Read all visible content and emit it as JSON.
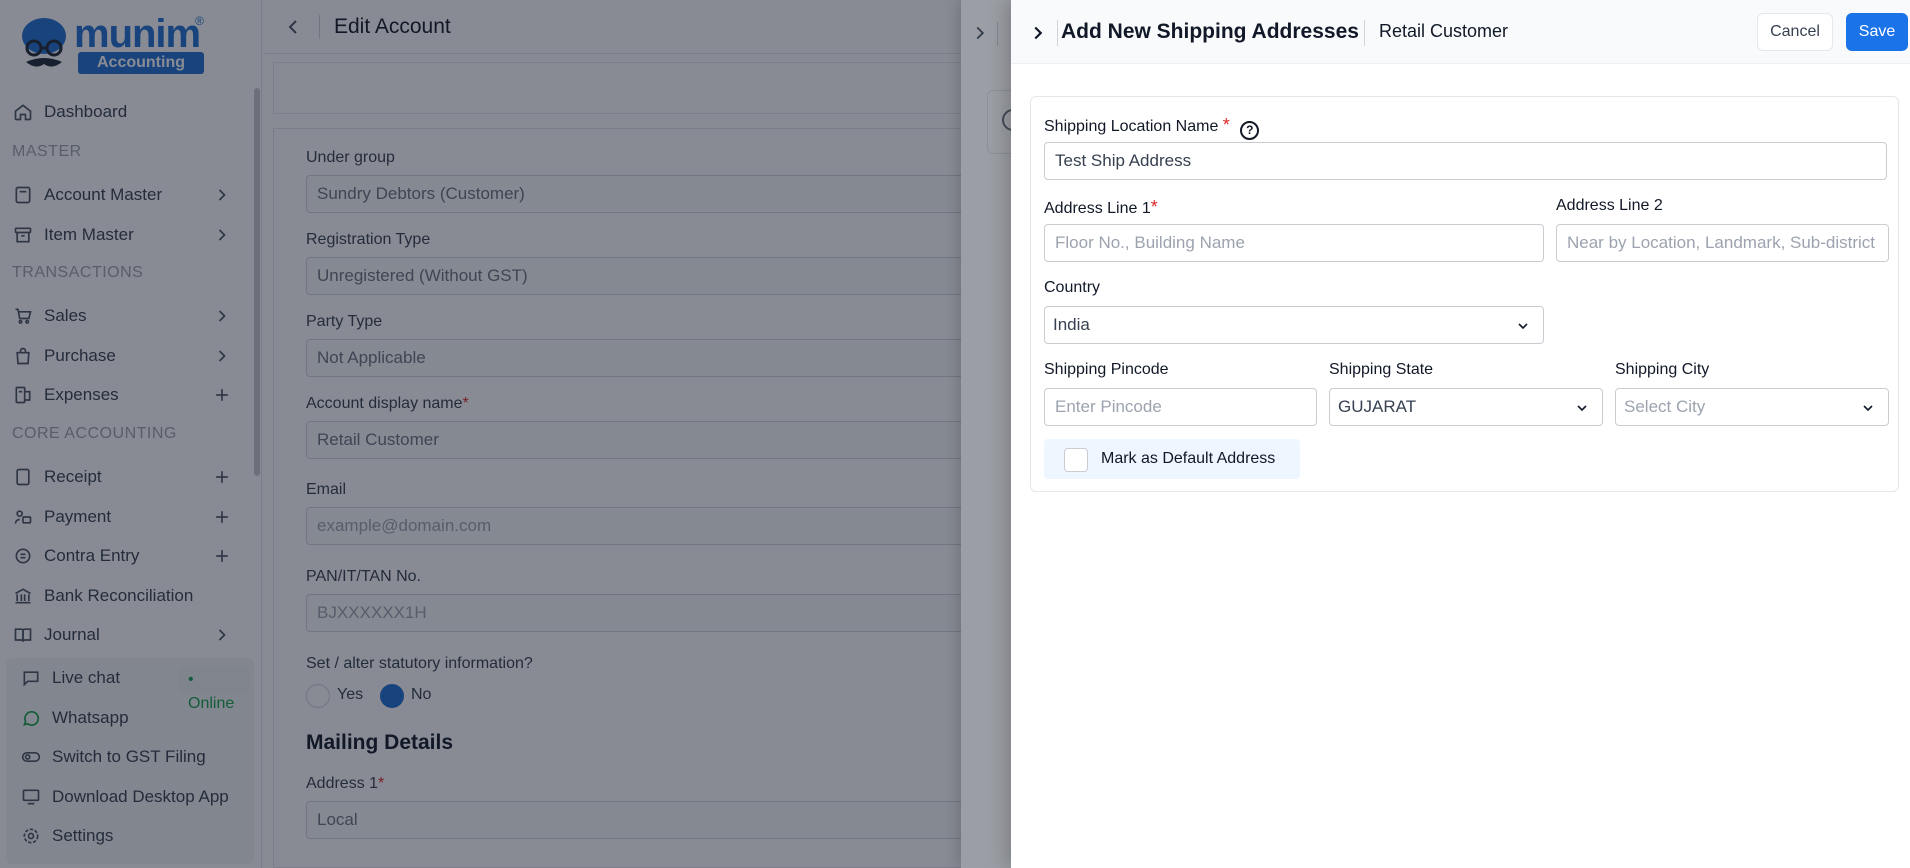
{
  "brand": {
    "name": "munim",
    "tagline": "Accounting",
    "reg": "®"
  },
  "sidebar": {
    "dashboard": "Dashboard",
    "sections": {
      "master": "MASTER",
      "transactions": "TRANSACTIONS",
      "core": "CORE ACCOUNTING"
    },
    "items": {
      "account_master": "Account Master",
      "item_master": "Item Master",
      "sales": "Sales",
      "purchase": "Purchase",
      "expenses": "Expenses",
      "receipt": "Receipt",
      "payment": "Payment",
      "contra_entry": "Contra Entry",
      "bank_reconciliation": "Bank Reconciliation",
      "journal": "Journal"
    },
    "bottom": {
      "live_chat": "Live chat",
      "online": "• Online",
      "whatsapp": "Whatsapp",
      "switch_gst": "Switch to GST Filing",
      "download_app": "Download Desktop App",
      "settings": "Settings"
    }
  },
  "page": {
    "title": "Edit Account",
    "fields": {
      "under_group": {
        "label": "Under group",
        "value": "Sundry Debtors (Customer)"
      },
      "registration_type": {
        "label": "Registration Type",
        "value": "Unregistered (Without GST)"
      },
      "party_type": {
        "label": "Party Type",
        "value": "Not Applicable"
      },
      "display_name": {
        "label": "Account display name",
        "required": "*",
        "value": "Retail Customer"
      },
      "email": {
        "label": "Email",
        "placeholder": "example@domain.com"
      },
      "pan": {
        "label": "PAN/IT/TAN No.",
        "placeholder": "BJXXXXXX1H"
      },
      "statutory": {
        "label": "Set / alter statutory information?",
        "yes": "Yes",
        "no": "No"
      },
      "address1": {
        "label": "Address 1",
        "required": "*",
        "value": "Local"
      }
    },
    "mailing_title": "Mailing Details"
  },
  "drawer": {
    "title": "Add New Shipping Addresses",
    "subtitle": "Retail Customer",
    "cancel": "Cancel",
    "save": "Save",
    "help": "?",
    "location_name": {
      "label": "Shipping Location Name",
      "required": "*",
      "value": "Test Ship Address"
    },
    "address1": {
      "label": "Address Line 1",
      "required": "*",
      "placeholder": "Floor No., Building Name"
    },
    "address2": {
      "label": "Address Line 2",
      "placeholder": "Near by Location, Landmark, Sub-district"
    },
    "country": {
      "label": "Country",
      "value": "India"
    },
    "pincode": {
      "label": "Shipping Pincode",
      "placeholder": "Enter Pincode"
    },
    "state": {
      "label": "Shipping State",
      "value": "GUJARAT"
    },
    "city": {
      "label": "Shipping City",
      "placeholder": "Select City"
    },
    "default_label": "Mark as Default Address"
  },
  "colors": {
    "primary": "#1a73e8",
    "required": "#dc2626",
    "online": "#16a34a"
  }
}
